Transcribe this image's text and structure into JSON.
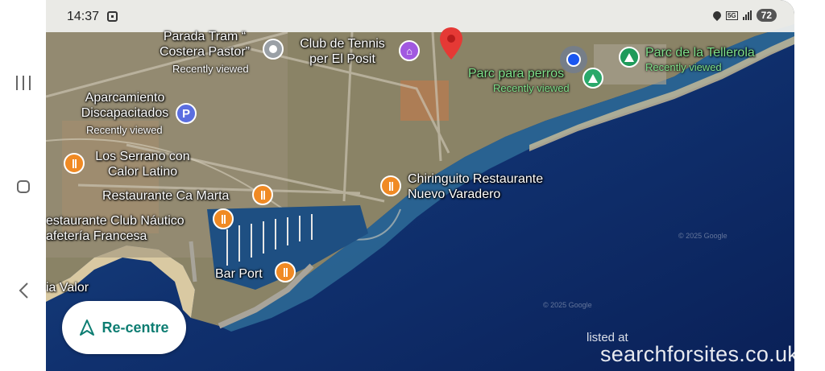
{
  "status_bar": {
    "time": "14:37",
    "battery": "72",
    "network": "5G"
  },
  "places": {
    "tram_stop": {
      "line1": "Parada Tram “",
      "line2": "Costera Pastor”",
      "sub": "Recently viewed"
    },
    "tennis": {
      "line1": "Club de Tennis",
      "line2": "per El Posit"
    },
    "dog_park": {
      "line1": "Parc para perros",
      "sub": "Recently viewed"
    },
    "tellerola": {
      "line1": "Parc de la Tellerola",
      "sub": "Recently viewed"
    },
    "parking": {
      "line1": "Aparcamiento",
      "line2": "Discapacitados",
      "sub": "Recently viewed"
    },
    "serrano": {
      "line1": "Los Serrano con",
      "line2": "Calor Latino"
    },
    "chiringuito": {
      "line1": "Chiringuito Restaurante",
      "line2": "Nuevo Varadero"
    },
    "ca_marta": {
      "line1": "Restaurante Ca Marta"
    },
    "club_nautico": {
      "line1": "estaurante Club Náutico",
      "line2": "afetería Francesa"
    },
    "valor": {
      "line1": "ia Valor"
    },
    "bar_port": {
      "line1": "Bar Port"
    }
  },
  "recentre": {
    "label": "Re-centre"
  },
  "watermark": {
    "small": "listed at",
    "big": "searchforsites.co.uk"
  },
  "copyright": {
    "a": "© 2025 Google",
    "b": "© 2025 Google"
  },
  "icons": {
    "recents": "recents-icon",
    "home": "home-icon",
    "back": "back-icon",
    "food": "restaurant-icon",
    "park": "tree-icon",
    "parking": "parking-icon",
    "sport": "sports-club-icon",
    "tram": "transit-icon",
    "pin": "red-location-pin-icon",
    "me": "my-location-icon",
    "navigation": "navigation-arrow-icon"
  },
  "colors": {
    "sea": "#0d2a6e",
    "land": "#8c8468",
    "food_pin": "#f08a24",
    "park_pin": "#1e9a5a",
    "parking_pin": "#5b6ee0",
    "sport_pin": "#a159e0",
    "recentre_text": "#0d7d72"
  }
}
